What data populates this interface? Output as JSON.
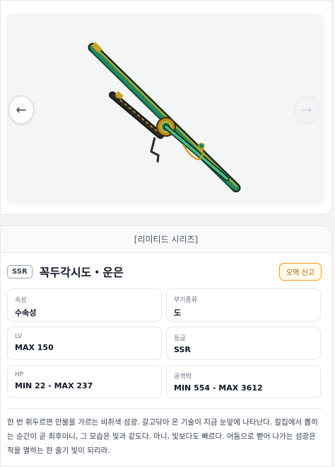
{
  "viewer": {
    "prev_icon": "←",
    "next_icon": "→",
    "image_subject": "weapon-image",
    "icons": {
      "prev": "arrow-left-icon",
      "next": "arrow-right-icon"
    }
  },
  "item": {
    "series": "[리미티드 시리즈]",
    "rarity_badge": "SSR",
    "name": "꼭두각시도・운은",
    "report_label": "오역 신고",
    "stats": [
      {
        "label": "속성",
        "value": "수속성"
      },
      {
        "label": "무기종류",
        "value": "도"
      },
      {
        "label": "LV",
        "value": "MAX 150"
      },
      {
        "label": "등급",
        "value": "SSR"
      },
      {
        "label": "HP",
        "value": "MIN 22 - MAX 237"
      },
      {
        "label": "공격력",
        "value": "MIN 554 - MAX 3612"
      }
    ],
    "description": "한 번 휘두르면 만물을 가르는 비취색 섬광. 갈고닦아 온 기술이 지금 눈앞에 나타난다. 칼집에서 뽑히는 순간이 곧 최후이니, 그 모습은 빛과 같도다. 아니, 빛보다도 빠르다. 어둠으로 뻗어 나가는 섬광은 적을 멸하는 한 줄기 빛이 되리라."
  },
  "colors": {
    "accent_warning": "#f59e0b",
    "report_text": "#b45309",
    "blade_green": "#1f8a5f",
    "gold_trim": "#c9a227"
  }
}
